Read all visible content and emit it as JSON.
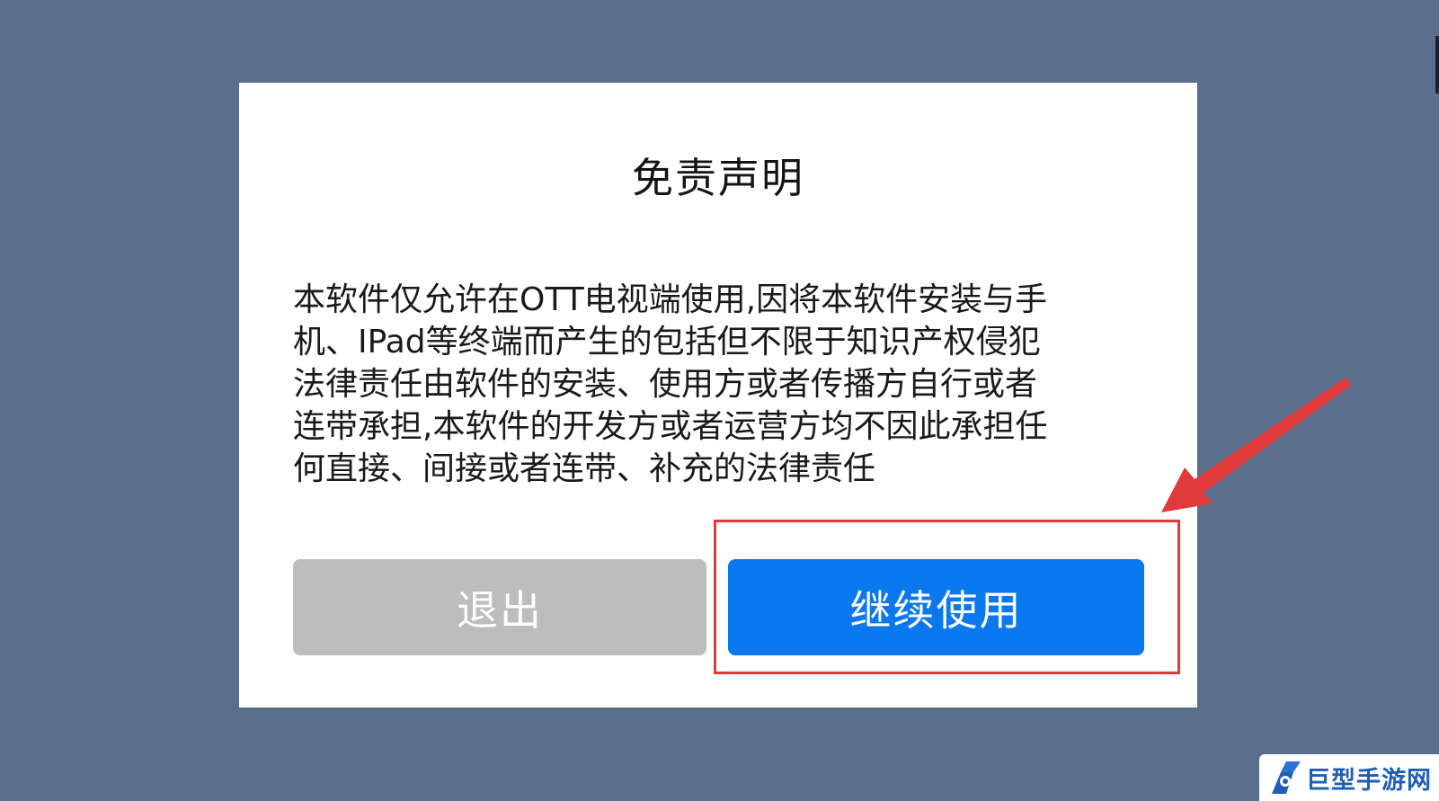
{
  "dialog": {
    "title": "免责声明",
    "body_lines": [
      "本软件仅允许在OTT电视端使用,因将本软件安装与手",
      "机、IPad等终端而产生的包括但不限于知识产权侵犯",
      "法律责任由软件的安装、使用方或者传播方自行或者",
      "连带承担,本软件的开发方或者运营方均不因此承担任",
      "何直接、间接或者连带、补充的法律责任"
    ],
    "exit_label": "退出",
    "continue_label": "继续使用"
  },
  "watermark": {
    "text": "巨型手游网",
    "logo_icon": "brand-logo-icon"
  },
  "annotation": {
    "highlight_color": "#e03a3a",
    "arrow_icon": "red-arrow-icon"
  },
  "colors": {
    "background": "#5b6e8b",
    "continue_button": "#0a78ee",
    "exit_button": "#bdbdbd"
  }
}
